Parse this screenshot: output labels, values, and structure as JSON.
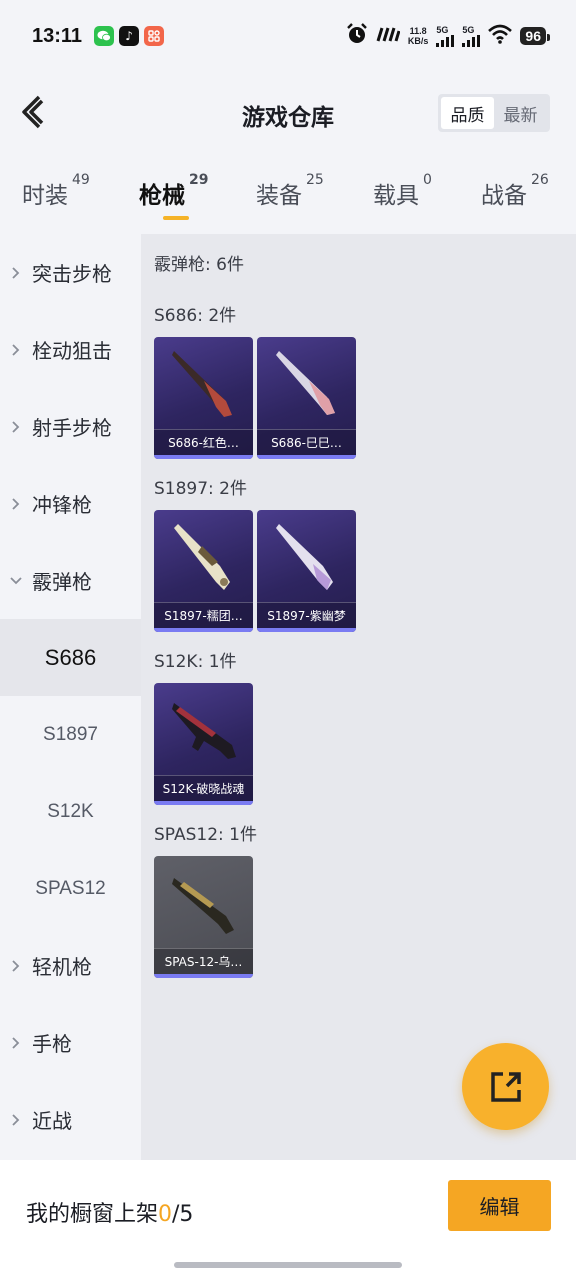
{
  "status_bar": {
    "time": "13:11",
    "net_speed_value": "11.8",
    "net_speed_unit": "KB/s",
    "sig1_label": "5G",
    "sig2_label": "5G",
    "battery": "96",
    "icons": [
      "wechat-icon",
      "tiktok-icon",
      "app-icon",
      "alarm-icon",
      "vibrate-icon",
      "signal-icon",
      "wifi-icon",
      "battery-icon"
    ]
  },
  "header": {
    "title": "游戏仓库",
    "sort_options": [
      "品质",
      "最新"
    ],
    "sort_selected": "品质"
  },
  "tabs": [
    {
      "label": "时装",
      "count": "49"
    },
    {
      "label": "枪械",
      "count": "29",
      "active": true
    },
    {
      "label": "装备",
      "count": "25"
    },
    {
      "label": "载具",
      "count": "0"
    },
    {
      "label": "战备",
      "count": "26"
    }
  ],
  "sidebar": {
    "categories": [
      {
        "label": "突击步枪",
        "expanded": false
      },
      {
        "label": "栓动狙击",
        "expanded": false
      },
      {
        "label": "射手步枪",
        "expanded": false
      },
      {
        "label": "冲锋枪",
        "expanded": false
      },
      {
        "label": "霰弹枪",
        "expanded": true
      },
      {
        "label": "轻机枪",
        "expanded": false
      },
      {
        "label": "手枪",
        "expanded": false
      },
      {
        "label": "近战",
        "expanded": false
      }
    ],
    "subitems": [
      "S686",
      "S1897",
      "S12K",
      "SPAS12"
    ],
    "selected_subitem": "S686"
  },
  "main": {
    "category_summary": "霰弹枪: 6件",
    "groups": [
      {
        "title": "S686: 2件",
        "items": [
          {
            "label": "S686-红色…",
            "rarity": "purple"
          },
          {
            "label": "S686-巳巳…",
            "rarity": "purple"
          }
        ]
      },
      {
        "title": "S1897: 2件",
        "items": [
          {
            "label": "S1897-糯团…",
            "rarity": "purple"
          },
          {
            "label": "S1897-紫幽梦",
            "rarity": "purple"
          }
        ]
      },
      {
        "title": "S12K: 1件",
        "items": [
          {
            "label": "S12K-破晓战魂",
            "rarity": "purple"
          }
        ]
      },
      {
        "title": "SPAS12: 1件",
        "items": [
          {
            "label": "SPAS-12-乌…",
            "rarity": "gray"
          }
        ]
      }
    ]
  },
  "footer": {
    "showcase_label": "我的橱窗上架",
    "showcase_used": "0",
    "showcase_total": "/5",
    "edit_label": "编辑"
  },
  "colors": {
    "accent": "#f5a623",
    "rarity_purple": "#2e2560",
    "rarity_gray": "#4a4b52",
    "rarity_strip": "#7a7bf2"
  }
}
